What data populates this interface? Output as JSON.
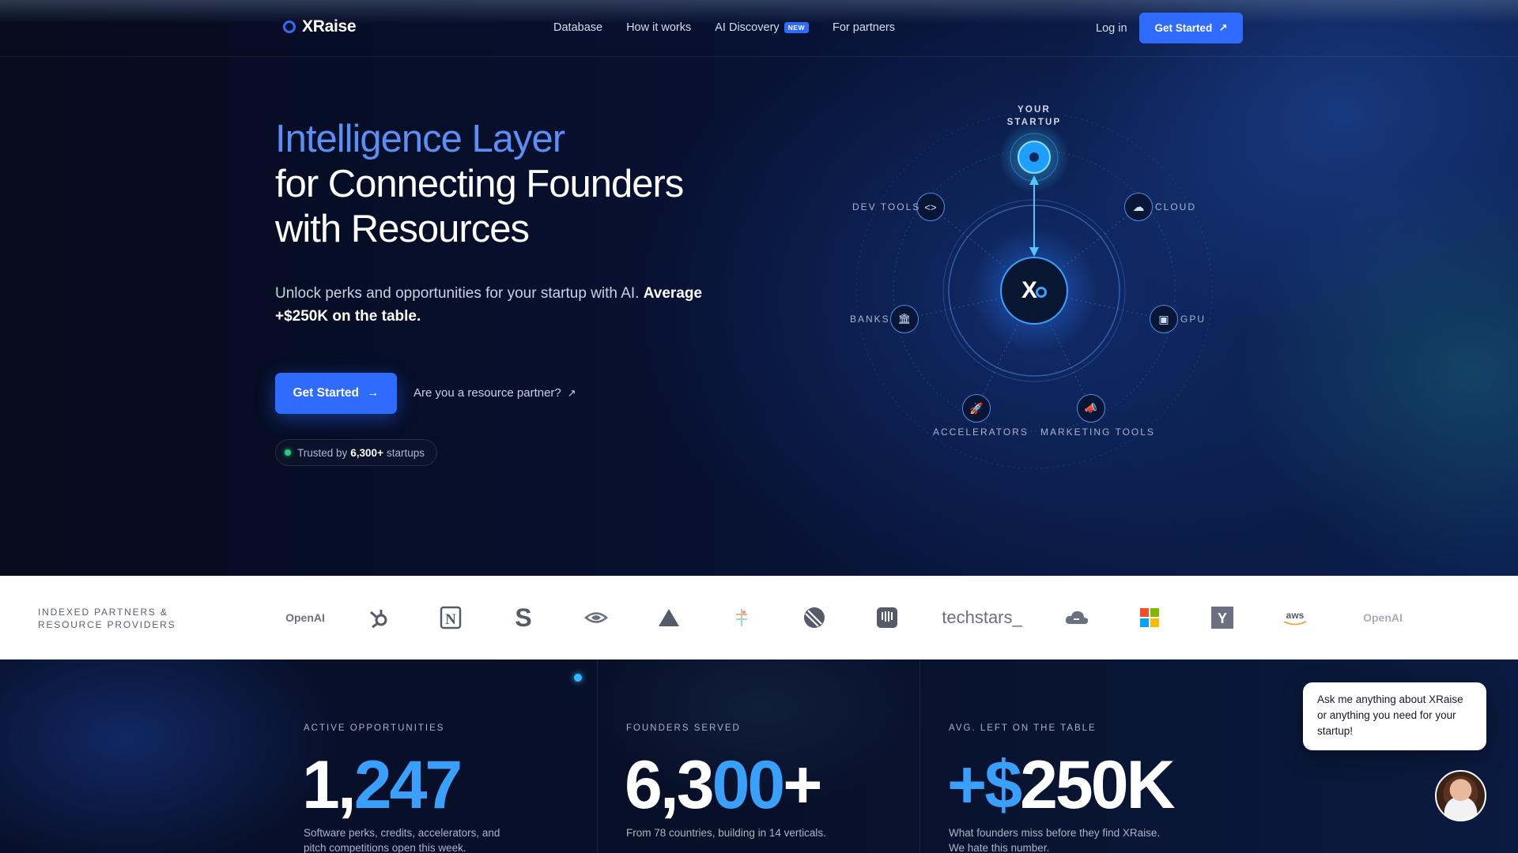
{
  "nav": {
    "brand": "XRaise",
    "links": [
      {
        "label": "Database"
      },
      {
        "label": "How it works"
      },
      {
        "label": "AI Discovery",
        "badge": "NEW"
      },
      {
        "label": "For partners"
      }
    ],
    "login": "Log in",
    "cta": "Get Started"
  },
  "hero": {
    "title_accent": "Intelligence Layer",
    "title_line2": "for Connecting Founders",
    "title_line3": "with Resources",
    "subtitle_plain": "Unlock perks and opportunities for your startup with AI.",
    "subtitle_bold": "Average +$250K on the table.",
    "cta": "Get Started",
    "partner_link": "Are you a resource partner?",
    "trusted_prefix": "Trusted by",
    "trusted_count": "6,300+",
    "trusted_suffix": "startups"
  },
  "diagram": {
    "top_label_1": "YOUR",
    "top_label_2": "STARTUP",
    "center": "X",
    "nodes": {
      "dev_tools": "DEV TOOLS",
      "cloud": "CLOUD",
      "banks": "BANKS",
      "gpu": "GPU",
      "accelerators": "ACCELERATORS",
      "marketing": "MARKETING TOOLS"
    }
  },
  "partners": {
    "title_line1": "INDEXED PARTNERS &",
    "title_line2": "RESOURCE PROVIDERS",
    "logos": [
      "OpenAI",
      "hubspot-icon",
      "notion-icon",
      "stripe-icon",
      "nvidia-icon",
      "vercel-icon",
      "figma-icon",
      "linear-icon",
      "intercom-icon",
      "techstars_",
      "cloudflare-icon",
      "microsoft-icon",
      "ycombinator-icon",
      "aws",
      "OpenAI"
    ]
  },
  "stats": [
    {
      "label": "ACTIVE OPPORTUNITIES",
      "value_a": "1,",
      "value_b": "247",
      "value_c": "",
      "desc": "Software perks, credits, accelerators, and pitch competitions open this week."
    },
    {
      "label": "FOUNDERS SERVED",
      "value_a": "6,3",
      "value_b": "00",
      "value_c": "+",
      "desc": "From 78 countries, building in 14 verticals."
    },
    {
      "label": "AVG. LEFT ON THE TABLE",
      "value_a": "",
      "value_b": "+$",
      "value_c": "250K",
      "desc": "What founders miss before they find XRaise. We hate this number."
    }
  ],
  "chat": {
    "message": "Ask me anything about XRaise or anything you need for your startup!"
  },
  "colors": {
    "accent": "#2f6bff",
    "title_accent": "#5b8ff5",
    "stat_blue": "#3aa0ff",
    "bg": "#060d22"
  }
}
